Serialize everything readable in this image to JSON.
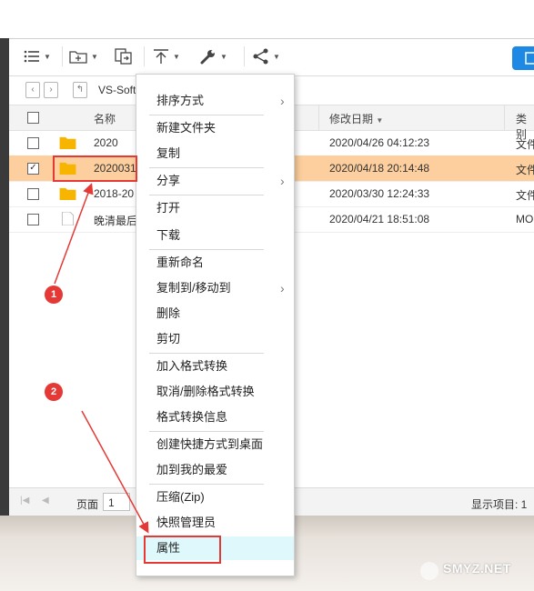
{
  "toolbar": {
    "icons": [
      "list-icon",
      "new-folder-icon",
      "copy-file-icon",
      "upload-icon",
      "tools-icon",
      "share-icon"
    ]
  },
  "path": {
    "current": "VS-Soft"
  },
  "table": {
    "columns": [
      "名称",
      "修改日期",
      "类别"
    ],
    "rows": [
      {
        "name": "2020",
        "date": "2020/04/26 04:12:23",
        "type": "文件",
        "checked": false,
        "icon": "folder",
        "selected": false
      },
      {
        "name": "2020031",
        "date": "2020/04/18 20:14:48",
        "type": "文件",
        "checked": true,
        "icon": "folder",
        "selected": true
      },
      {
        "name": "2018-20",
        "date": "2020/03/30 12:24:33",
        "type": "文件",
        "checked": false,
        "icon": "folder",
        "selected": false
      },
      {
        "name": "晚清最后",
        "date": "2020/04/21 18:51:08",
        "type": "MO",
        "checked": false,
        "icon": "file",
        "selected": false
      }
    ]
  },
  "footer": {
    "page_label": "页面",
    "page_value": "1",
    "display_label": "显示项目: 1"
  },
  "context_menu": {
    "items": [
      {
        "label": "排序方式",
        "submenu": true
      },
      {
        "label": "新建文件夹"
      },
      {
        "label": "复制"
      },
      {
        "label": "分享",
        "submenu": true
      },
      {
        "label": "打开"
      },
      {
        "label": "下载"
      },
      {
        "label": "重新命名"
      },
      {
        "label": "复制到/移动到",
        "submenu": true
      },
      {
        "label": "删除"
      },
      {
        "label": "剪切"
      },
      {
        "label": "加入格式转换"
      },
      {
        "label": "取消/删除格式转换"
      },
      {
        "label": "格式转换信息"
      },
      {
        "label": "创建快捷方式到桌面"
      },
      {
        "label": "加到我的最爱"
      },
      {
        "label": "压缩(Zip)"
      },
      {
        "label": "快照管理员"
      },
      {
        "label": "属性",
        "highlighted": true
      }
    ]
  },
  "annotations": {
    "badge1": "1",
    "badge2": "2"
  },
  "watermark": "SMYZ.NET",
  "colors": {
    "selected_row": "#fdcf9e",
    "highlight": "#def8fb",
    "annotation_red": "#e53935",
    "folder": "#f7b500",
    "accent": "#1e88e5"
  }
}
